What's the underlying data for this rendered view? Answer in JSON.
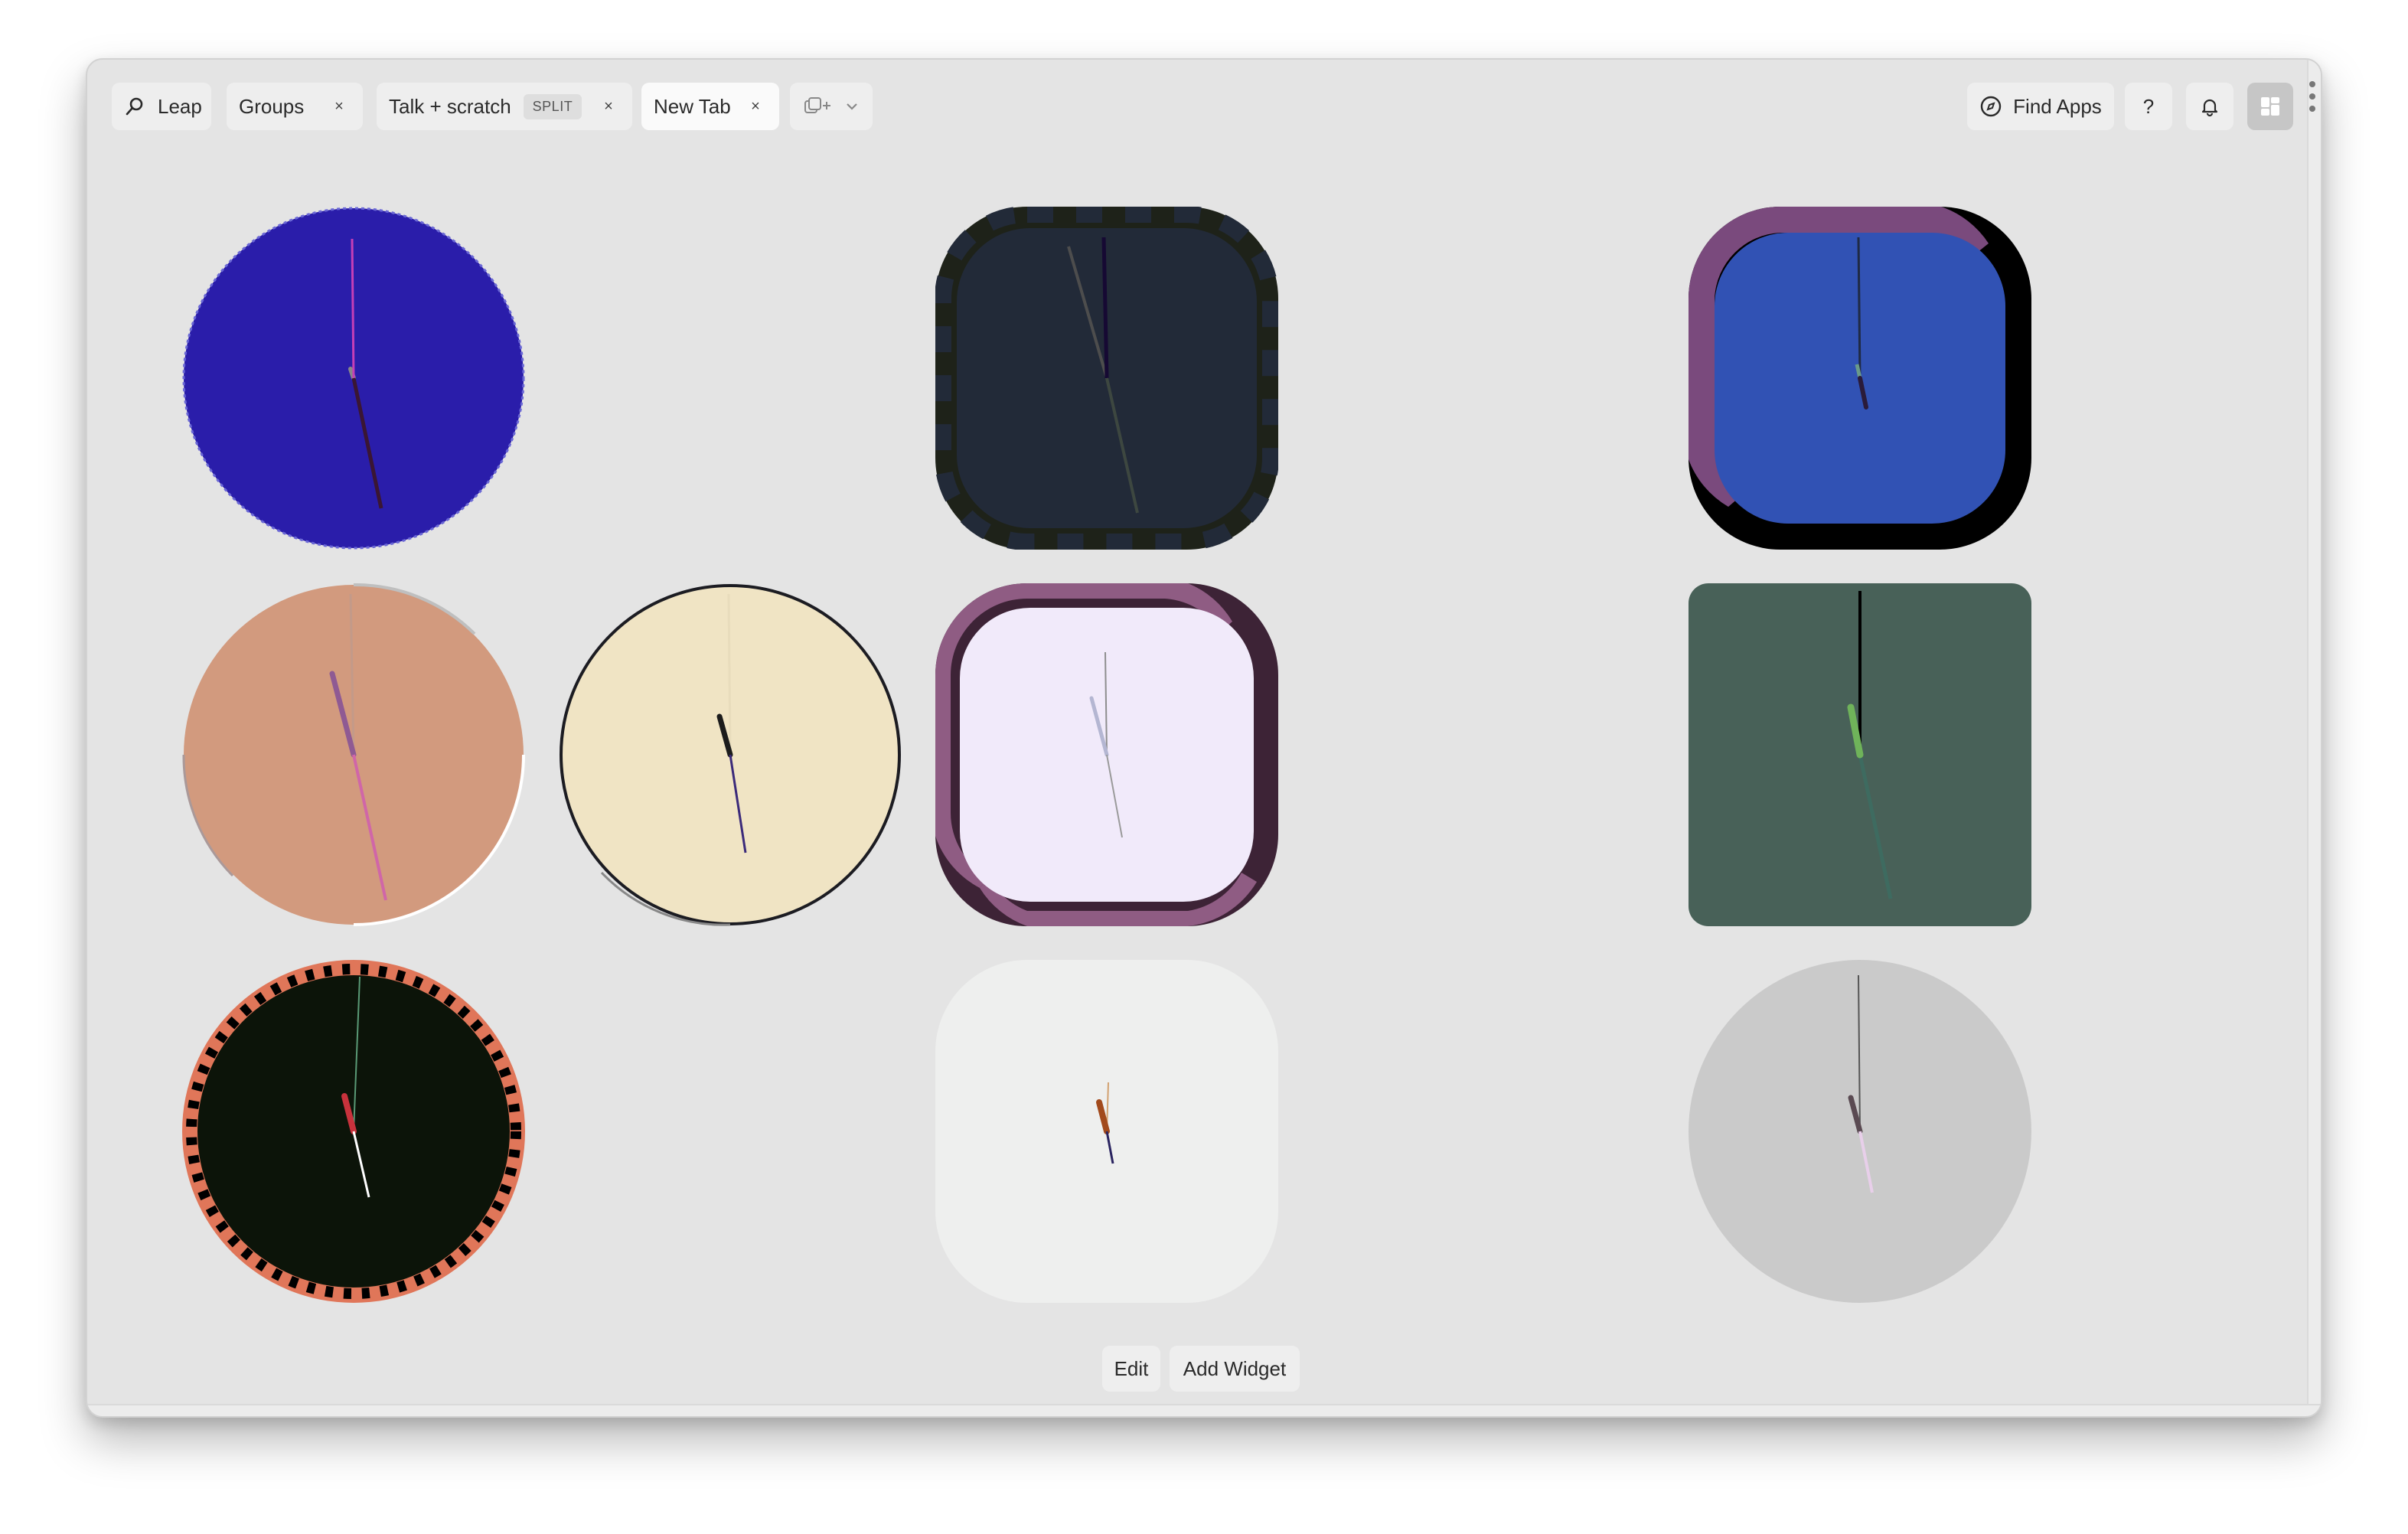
{
  "tabs": {
    "leap": {
      "label": "Leap",
      "icon": "search-icon"
    },
    "groups": {
      "label": "Groups",
      "close": "×"
    },
    "talk_scratch": {
      "label": "Talk + scratch",
      "badge": "SPLIT",
      "close": "×"
    },
    "new_tab": {
      "label": "New Tab",
      "close": "×"
    },
    "new_tab_menu": {
      "icon": "add-tab-icon",
      "dropdown_icon": "chevron-down-icon"
    }
  },
  "toolbar": {
    "find_apps": {
      "label": "Find Apps",
      "icon": "compass-icon"
    },
    "help": {
      "label": "?"
    },
    "notifications": {
      "icon": "bell-icon"
    },
    "widgets_view": {
      "icon": "dashboard-icon"
    }
  },
  "clocks": [
    {
      "id": "clock-1",
      "face": "#2a1daa",
      "shape": "circle"
    },
    {
      "id": "clock-2",
      "face": "#222a38",
      "shape": "squircle"
    },
    {
      "id": "clock-3",
      "face": "#3152b4",
      "shape": "squircle"
    },
    {
      "id": "clock-4",
      "face": "#d29a7e",
      "shape": "circle"
    },
    {
      "id": "clock-5",
      "face": "#f0e4c4",
      "shape": "circle"
    },
    {
      "id": "clock-6",
      "face": "#f1eafa",
      "shape": "squircle"
    },
    {
      "id": "clock-7",
      "face": "#486158",
      "shape": "rounded-square"
    },
    {
      "id": "clock-8",
      "face": "#0c1409",
      "shape": "circle"
    },
    {
      "id": "clock-9",
      "face": "#eeefee",
      "shape": "squircle"
    },
    {
      "id": "clock-10",
      "face": "#cacaca",
      "shape": "circle"
    }
  ],
  "bottom": {
    "edit": "Edit",
    "add_widget": "Add Widget"
  }
}
